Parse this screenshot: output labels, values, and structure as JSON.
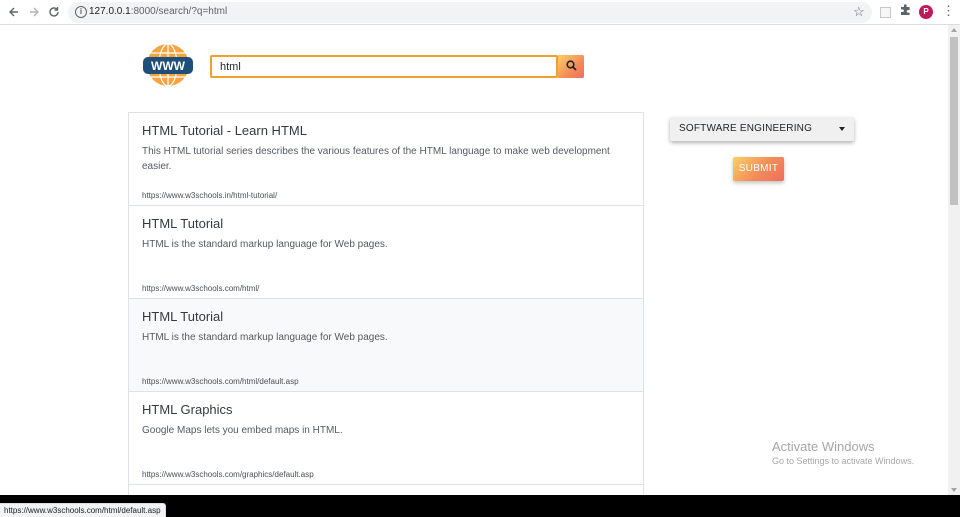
{
  "browser": {
    "url_host": "127.0.0.1",
    "url_rest": ":8000/search/?q=html",
    "profile_initial": "P",
    "icons": [
      "back-icon",
      "forward-icon",
      "reload-icon",
      "info-icon",
      "star-icon",
      "extension-icon",
      "puzzle-icon",
      "menu-icon"
    ]
  },
  "search": {
    "value": "html",
    "button_icon": "search-icon"
  },
  "results": [
    {
      "title": "HTML Tutorial - Learn HTML",
      "description": "This HTML tutorial series describes the various features of the HTML language to make web development easier.",
      "url": "https://www.w3schools.in/html-tutorial/"
    },
    {
      "title": "HTML Tutorial",
      "description": "HTML is the standard markup language for Web pages.",
      "url": "https://www.w3schools.com/html/"
    },
    {
      "title": "HTML Tutorial",
      "description": "HTML is the standard markup language for Web pages.",
      "url": "https://www.w3schools.com/html/default.asp"
    },
    {
      "title": "HTML Graphics",
      "description": "Google Maps lets you embed maps in HTML.",
      "url": "https://www.w3schools.com/graphics/default.asp"
    }
  ],
  "category": {
    "selected": "SOFTWARE ENGINEERING"
  },
  "submit": {
    "label": "SUBMIT"
  },
  "watermark": {
    "title": "Activate Windows",
    "subtitle": "Go to Settings to activate Windows."
  },
  "status": {
    "hover_url": "https://www.w3schools.com/html/default.asp"
  },
  "logo": {
    "text": "WWW"
  },
  "colors": {
    "accent_orange": "#f0a030",
    "gradient_start": "#fdd064",
    "gradient_end": "#f06d5c",
    "logo_blue": "#1f4e79",
    "profile": "#c2185b"
  }
}
